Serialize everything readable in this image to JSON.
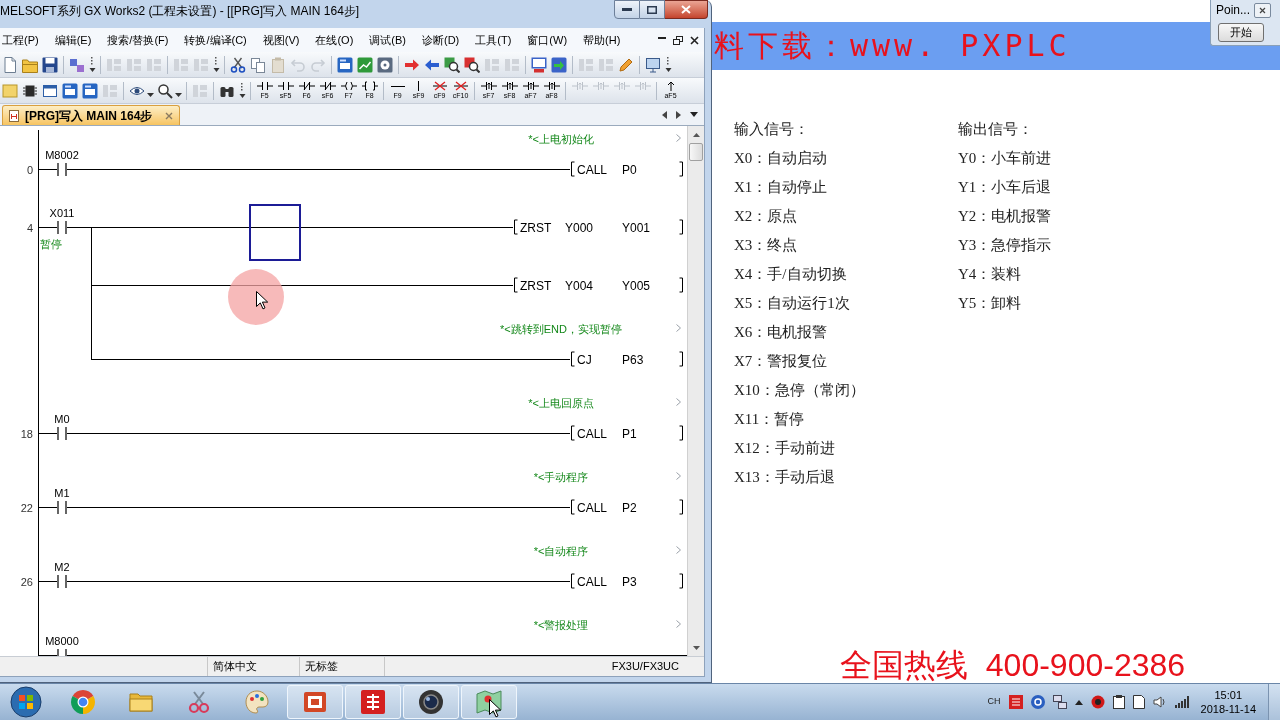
{
  "window": {
    "title": "MELSOFT系列 GX Works2 (工程未设置) - [[PRG]写入 MAIN 164步]"
  },
  "menu": [
    "工程(P)",
    "编辑(E)",
    "搜索/替换(F)",
    "转换/编译(C)",
    "视图(V)",
    "在线(O)",
    "调试(B)",
    "诊断(D)",
    "工具(T)",
    "窗口(W)",
    "帮助(H)"
  ],
  "ladder_keys": [
    [
      {
        "label": "F5",
        "kind": "contact",
        "disabled": false
      },
      {
        "label": "sF5",
        "kind": "contact",
        "disabled": false
      },
      {
        "label": "F6",
        "kind": "contact-nc",
        "disabled": false
      },
      {
        "label": "sF6",
        "kind": "contact-nc",
        "disabled": false
      },
      {
        "label": "F7",
        "kind": "coil",
        "disabled": false
      },
      {
        "label": "F8",
        "kind": "instruction",
        "disabled": false
      }
    ],
    [
      {
        "label": "F9",
        "kind": "line",
        "disabled": false
      },
      {
        "label": "sF9",
        "kind": "vline",
        "disabled": false
      },
      {
        "label": "cF9",
        "kind": "delete",
        "disabled": false
      },
      {
        "label": "cF10",
        "kind": "delete",
        "disabled": false
      }
    ],
    [
      {
        "label": "sF7",
        "kind": "pulse",
        "disabled": false
      },
      {
        "label": "sF8",
        "kind": "pulse",
        "disabled": false
      },
      {
        "label": "aF7",
        "kind": "pulse",
        "disabled": false
      },
      {
        "label": "aF8",
        "kind": "pulse",
        "disabled": false
      }
    ],
    [
      {
        "kind": "pulse",
        "disabled": true
      },
      {
        "kind": "pulse",
        "disabled": true
      },
      {
        "kind": "pulse",
        "disabled": true
      },
      {
        "kind": "pulse",
        "disabled": true
      }
    ],
    [
      {
        "label": "aF5",
        "kind": "arrow",
        "disabled": false
      }
    ]
  ],
  "tabs": [
    {
      "label": "[PRG]写入 MAIN 164步",
      "selected": true
    }
  ],
  "ladder": {
    "rungs": [
      {
        "comment": "*<上电初始化",
        "step": "0",
        "contact": "M8002",
        "outputs": [
          {
            "instruction": "CALL",
            "operands": [
              "P0"
            ]
          }
        ]
      },
      {
        "step": "4",
        "contact": "X011",
        "contact_comment": "暂停",
        "outputs": [
          {
            "instruction": "ZRST",
            "operands": [
              "Y000",
              "Y001"
            ]
          },
          {
            "instruction": "ZRST",
            "operands": [
              "Y004",
              "Y005"
            ]
          },
          {
            "comment": "*<跳转到END，实现暂停",
            "instruction": "CJ",
            "operands": [
              "P63"
            ]
          }
        ]
      },
      {
        "comment": "*<上电回原点",
        "step": "18",
        "contact": "M0",
        "outputs": [
          {
            "instruction": "CALL",
            "operands": [
              "P1"
            ]
          }
        ]
      },
      {
        "comment": "*<手动程序",
        "step": "22",
        "contact": "M1",
        "outputs": [
          {
            "instruction": "CALL",
            "operands": [
              "P2"
            ]
          }
        ]
      },
      {
        "comment": "*<自动程序",
        "step": "26",
        "contact": "M2",
        "outputs": [
          {
            "instruction": "CALL",
            "operands": [
              "P3"
            ]
          }
        ]
      },
      {
        "comment": "*<警报处理",
        "contact": "M8000"
      }
    ]
  },
  "status_bar": [
    "简体中文",
    "无标签",
    "FX3U/FX3UC"
  ],
  "slide": {
    "banner": "料下载：www. PXPLC",
    "inputs": {
      "heading": "输入信号：",
      "items": [
        "X0：自动启动",
        "X1：自动停止",
        "X2：原点",
        "X3：终点",
        "X4：手/自动切换",
        "X5：自动运行1次",
        "X6：电机报警",
        "X7：警报复位",
        "X10：急停（常闭）",
        "X11：暂停",
        "X12：手动前进",
        "X13：手动后退"
      ]
    },
    "outputs": {
      "heading": "输出信号：",
      "items": [
        "Y0：小车前进",
        "Y1：小车后退",
        "Y2：电机报警",
        "Y3：急停指示",
        "Y4：装料",
        "Y5：卸料"
      ]
    },
    "hotline": "全国热线  400-900-2386"
  },
  "popup": {
    "title": "Poin...",
    "button": "开始"
  },
  "taskbar": {
    "apps": [
      {
        "open": false
      },
      {
        "open": false
      },
      {
        "open": false
      },
      {
        "open": false
      },
      {
        "open": true
      },
      {
        "open": true
      },
      {
        "open": true
      },
      {
        "open": true
      }
    ],
    "language": "CH",
    "time": "15:01",
    "date": "2018-11-14"
  }
}
